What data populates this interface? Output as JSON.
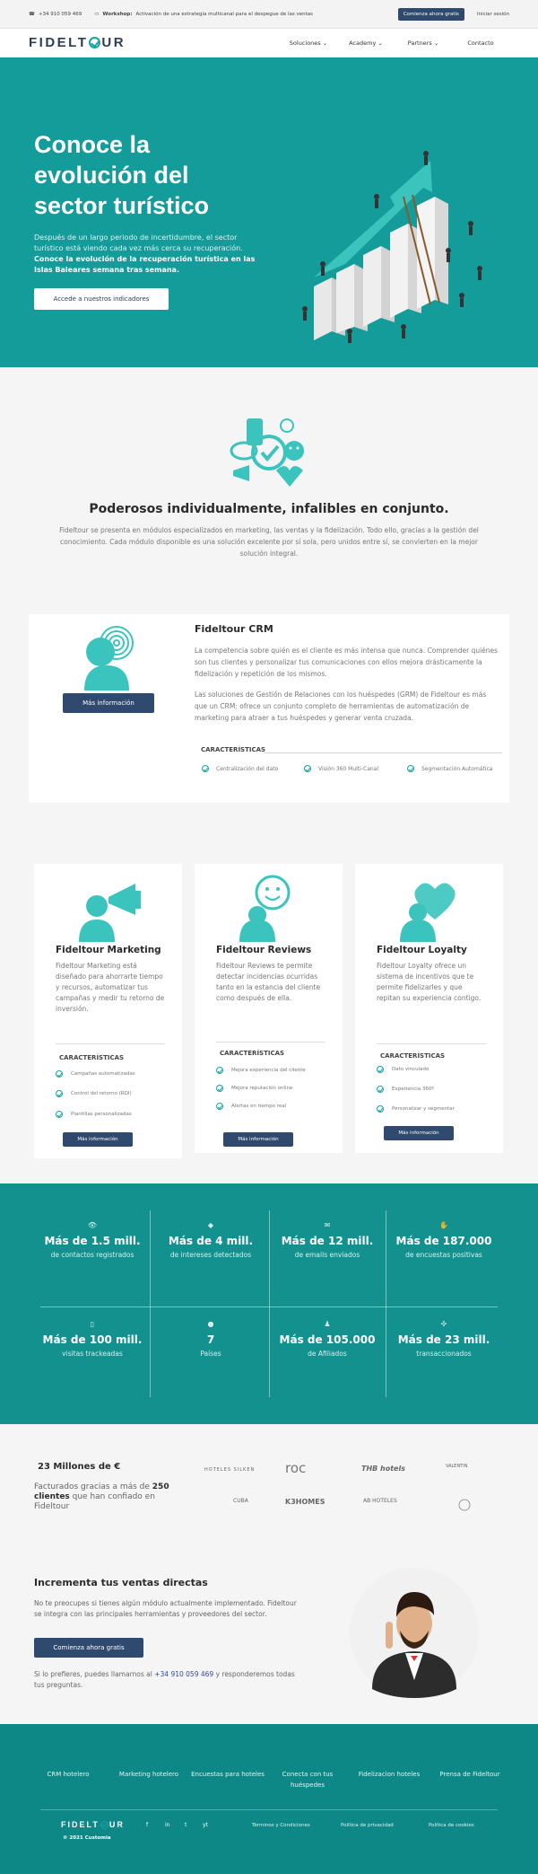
{
  "topbar": {
    "phone": "+34 910 059 469",
    "workshop_label": "Workshop:",
    "workshop_text": "Activación de una estrategia multicanal para el despegue de las ventas",
    "start_btn": "Comienza ahora gratis",
    "login": "Iniciar sesión"
  },
  "nav": {
    "logo_left": "FIDELT",
    "logo_right": "UR",
    "items": [
      "Soluciones",
      "Academy",
      "Partners",
      "Contacto"
    ]
  },
  "hero": {
    "title": "Conoce la evolución del sector turístico",
    "text": "Después de un largo periodo de incertidumbre, el sector turístico está viendo cada vez más cerca su recuperación.",
    "text_bold": "Conoce la evolución de la recuperación turística en las Islas Baleares semana tras semana.",
    "cta": "Accede a nuestros indicadores"
  },
  "intro": {
    "title": "Poderosos individualmente, infalibles en conjunto.",
    "text": "Fideltour se presenta en módulos especializados en marketing, las ventas y la fidelización. Todo ello, gracias a la gestión del conocimiento. Cada módulo disponible es una solución excelente por sí sola, pero unidos entre sí, se convierten en la mejor solución integral."
  },
  "crm": {
    "title": "Fideltour CRM",
    "text1": "La competencia sobre quién es el cliente es más intensa que nunca. Comprender quiénes son tus clientes y personalizar tus comunicaciones con ellos mejora drásticamente la fidelización y repetición de los mismos.",
    "text2": "Las soluciones de Gestión de Relaciones con los huéspedes (GRM) de Fideltour es más que un CRM: ofrece un conjunto completo de herramientas de automatización de marketing para atraer a tus huéspedes y generar venta cruzada.",
    "btn": "Más información",
    "features_title": "CARACTERÍSTICAS",
    "features": [
      "Centralización del dato",
      "Visión 360 Multi-Canal",
      "Segmentación Automática"
    ]
  },
  "cards": [
    {
      "title": "Fideltour Marketing",
      "text": "Fideltour Marketing está diseñado para ahorrarte tiempo y recursos, automatizar tus campañas y medir tu retorno de inversión.",
      "features_title": "CARACTERÍSTICAS",
      "features": [
        "Campañas automatizadas",
        "Control del retorno (ROI)",
        "Plantillas personalizadas"
      ],
      "btn": "Más información"
    },
    {
      "title": "Fideltour Reviews",
      "text": "Fideltour Reviews te permite detectar incidencias ocurridas tanto en la estancia del cliente como después de ella.",
      "features_title": "CARACTERÍSTICAS",
      "features": [
        "Mejora experiencia del cliente",
        "Mejora reputación online",
        "Alertas en tiempo real"
      ],
      "btn": "Más información"
    },
    {
      "title": "Fideltour Loyalty",
      "text": "Fideltour Loyalty ofrece un sistema de incentivos que te permite fidelizarles y que repitan su experiencia contigo.",
      "features_title": "CARACTERÍSTICAS",
      "features": [
        "Dato vinculado",
        "Experiencia 360º",
        "Personalizar y segmentar"
      ],
      "btn": "Más información"
    }
  ],
  "stats": [
    {
      "icon": "eye-icon",
      "value": "Más de 1.5 mill.",
      "label": "de contactos registrados"
    },
    {
      "icon": "tag-icon",
      "value": "Más de 4 mill.",
      "label": "de intereses detectados"
    },
    {
      "icon": "envelope-icon",
      "value": "Más de 12 mill.",
      "label": "de emails enviados"
    },
    {
      "icon": "thumbs-up-icon",
      "value": "Más de 187.000",
      "label": "de encuestas positivas"
    },
    {
      "icon": "bookmark-icon",
      "value": "Más de 100 mill.",
      "label": "visitas trackeadas"
    },
    {
      "icon": "globe-icon",
      "value": "7",
      "label": "Países"
    },
    {
      "icon": "users-icon",
      "value": "Más de 105.000",
      "label": "de Afiliados"
    },
    {
      "icon": "handshake-icon",
      "value": "Más de 23 mill.",
      "label": "transaccionados"
    }
  ],
  "clients": {
    "title": "23 Millones de €",
    "text_pre": "Facturados gracias a más de ",
    "text_bold": "250 clientes",
    "text_post": " que han confiado en Fideltour",
    "logos": [
      "HOTELES SILKEN",
      "roc",
      "THB hotels",
      "VALENTIN",
      "CUBA",
      "K3HOMES",
      "AB HOTELES",
      "logo-8"
    ]
  },
  "ventas": {
    "title": "Incrementa tus ventas directas",
    "text": "No te preocupes si tienes algún módulo actualmente implementado. Fideltour se integra con las principales herramientas y proveedores del sector.",
    "btn": "Comienza ahora gratis",
    "call_pre": "Si lo prefieres, puedes llamarnos al ",
    "call_phone": "+34 910 059 469",
    "call_post": " y responderemos todas tus preguntas."
  },
  "footer": {
    "links": [
      "CRM hotelero",
      "Marketing hotelero",
      "Encuestas para hoteles",
      "Conecta con tus huéspedes",
      "Fidelizacion hoteles",
      "Prensa de Fideltour"
    ],
    "copyright": "© 2021 Customia",
    "social": [
      "f",
      "in",
      "t",
      "yt"
    ],
    "legal": [
      "Términos y Condiciones",
      "Política de privacidad",
      "Política de cookies"
    ]
  },
  "colors": {
    "teal": "#139c9a",
    "navy": "#2f4a6e",
    "dark_teal": "#0d8886"
  }
}
